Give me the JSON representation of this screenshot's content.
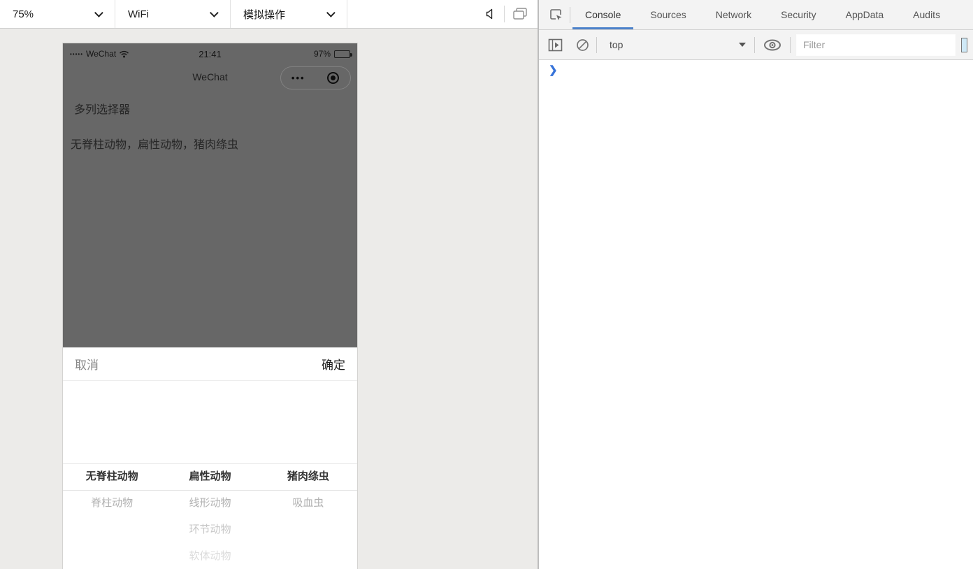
{
  "sim_toolbar": {
    "zoom_value": "75%",
    "network_value": "WiFi",
    "simulate_value": "模拟操作"
  },
  "phone": {
    "status_bar": {
      "signal_dots": "•••••",
      "carrier": "WeChat",
      "time": "21:41",
      "battery_percent": "97%"
    },
    "nav": {
      "title": "WeChat",
      "menu_dots": "•••"
    },
    "page": {
      "heading": "多列选择器",
      "selected_value": "无脊柱动物，扁性动物，猪肉绦虫"
    },
    "picker": {
      "cancel_label": "取消",
      "confirm_label": "确定",
      "columns": [
        {
          "items": [
            "无脊柱动物",
            "脊柱动物"
          ],
          "selected_index": 0
        },
        {
          "items": [
            "扁性动物",
            "线形动物",
            "环节动物",
            "软体动物"
          ],
          "selected_index": 0
        },
        {
          "items": [
            "猪肉绦虫",
            "吸血虫"
          ],
          "selected_index": 0
        }
      ]
    }
  },
  "devtools": {
    "tabs": [
      "Console",
      "Sources",
      "Network",
      "Security",
      "AppData",
      "Audits"
    ],
    "active_tab": "Console",
    "context_value": "top",
    "filter_placeholder": "Filter",
    "prompt_glyph": "❯"
  },
  "colors": {
    "dim_overlay": "#676767",
    "accent_blue": "#4d82ca",
    "prompt_blue": "#3673d9",
    "panel_gray": "#f3f3f3",
    "left_background": "#ecebe9"
  }
}
